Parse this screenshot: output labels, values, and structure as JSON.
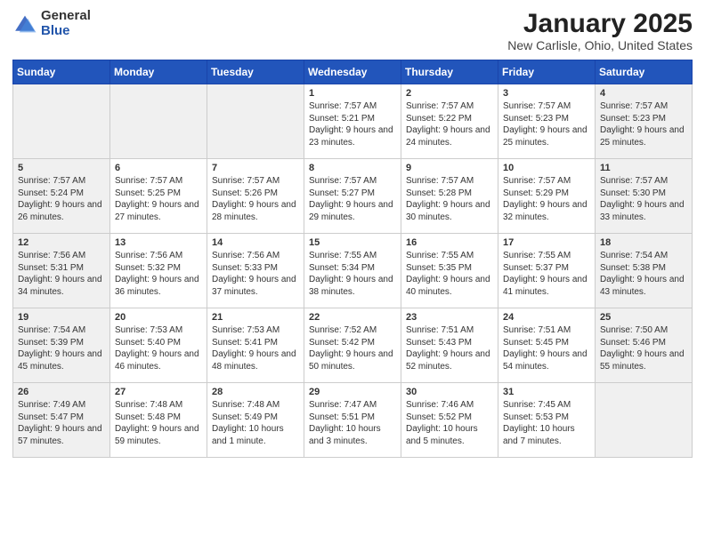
{
  "header": {
    "logo_general": "General",
    "logo_blue": "Blue",
    "title": "January 2025",
    "subtitle": "New Carlisle, Ohio, United States"
  },
  "weekdays": [
    "Sunday",
    "Monday",
    "Tuesday",
    "Wednesday",
    "Thursday",
    "Friday",
    "Saturday"
  ],
  "weeks": [
    [
      {
        "day": "",
        "detail": "",
        "shaded": true
      },
      {
        "day": "",
        "detail": "",
        "shaded": true
      },
      {
        "day": "",
        "detail": "",
        "shaded": true
      },
      {
        "day": "1",
        "detail": "Sunrise: 7:57 AM\nSunset: 5:21 PM\nDaylight: 9 hours and 23 minutes.",
        "shaded": false
      },
      {
        "day": "2",
        "detail": "Sunrise: 7:57 AM\nSunset: 5:22 PM\nDaylight: 9 hours and 24 minutes.",
        "shaded": false
      },
      {
        "day": "3",
        "detail": "Sunrise: 7:57 AM\nSunset: 5:23 PM\nDaylight: 9 hours and 25 minutes.",
        "shaded": false
      },
      {
        "day": "4",
        "detail": "Sunrise: 7:57 AM\nSunset: 5:23 PM\nDaylight: 9 hours and 25 minutes.",
        "shaded": true
      }
    ],
    [
      {
        "day": "5",
        "detail": "Sunrise: 7:57 AM\nSunset: 5:24 PM\nDaylight: 9 hours and 26 minutes.",
        "shaded": true
      },
      {
        "day": "6",
        "detail": "Sunrise: 7:57 AM\nSunset: 5:25 PM\nDaylight: 9 hours and 27 minutes.",
        "shaded": false
      },
      {
        "day": "7",
        "detail": "Sunrise: 7:57 AM\nSunset: 5:26 PM\nDaylight: 9 hours and 28 minutes.",
        "shaded": false
      },
      {
        "day": "8",
        "detail": "Sunrise: 7:57 AM\nSunset: 5:27 PM\nDaylight: 9 hours and 29 minutes.",
        "shaded": false
      },
      {
        "day": "9",
        "detail": "Sunrise: 7:57 AM\nSunset: 5:28 PM\nDaylight: 9 hours and 30 minutes.",
        "shaded": false
      },
      {
        "day": "10",
        "detail": "Sunrise: 7:57 AM\nSunset: 5:29 PM\nDaylight: 9 hours and 32 minutes.",
        "shaded": false
      },
      {
        "day": "11",
        "detail": "Sunrise: 7:57 AM\nSunset: 5:30 PM\nDaylight: 9 hours and 33 minutes.",
        "shaded": true
      }
    ],
    [
      {
        "day": "12",
        "detail": "Sunrise: 7:56 AM\nSunset: 5:31 PM\nDaylight: 9 hours and 34 minutes.",
        "shaded": true
      },
      {
        "day": "13",
        "detail": "Sunrise: 7:56 AM\nSunset: 5:32 PM\nDaylight: 9 hours and 36 minutes.",
        "shaded": false
      },
      {
        "day": "14",
        "detail": "Sunrise: 7:56 AM\nSunset: 5:33 PM\nDaylight: 9 hours and 37 minutes.",
        "shaded": false
      },
      {
        "day": "15",
        "detail": "Sunrise: 7:55 AM\nSunset: 5:34 PM\nDaylight: 9 hours and 38 minutes.",
        "shaded": false
      },
      {
        "day": "16",
        "detail": "Sunrise: 7:55 AM\nSunset: 5:35 PM\nDaylight: 9 hours and 40 minutes.",
        "shaded": false
      },
      {
        "day": "17",
        "detail": "Sunrise: 7:55 AM\nSunset: 5:37 PM\nDaylight: 9 hours and 41 minutes.",
        "shaded": false
      },
      {
        "day": "18",
        "detail": "Sunrise: 7:54 AM\nSunset: 5:38 PM\nDaylight: 9 hours and 43 minutes.",
        "shaded": true
      }
    ],
    [
      {
        "day": "19",
        "detail": "Sunrise: 7:54 AM\nSunset: 5:39 PM\nDaylight: 9 hours and 45 minutes.",
        "shaded": true
      },
      {
        "day": "20",
        "detail": "Sunrise: 7:53 AM\nSunset: 5:40 PM\nDaylight: 9 hours and 46 minutes.",
        "shaded": false
      },
      {
        "day": "21",
        "detail": "Sunrise: 7:53 AM\nSunset: 5:41 PM\nDaylight: 9 hours and 48 minutes.",
        "shaded": false
      },
      {
        "day": "22",
        "detail": "Sunrise: 7:52 AM\nSunset: 5:42 PM\nDaylight: 9 hours and 50 minutes.",
        "shaded": false
      },
      {
        "day": "23",
        "detail": "Sunrise: 7:51 AM\nSunset: 5:43 PM\nDaylight: 9 hours and 52 minutes.",
        "shaded": false
      },
      {
        "day": "24",
        "detail": "Sunrise: 7:51 AM\nSunset: 5:45 PM\nDaylight: 9 hours and 54 minutes.",
        "shaded": false
      },
      {
        "day": "25",
        "detail": "Sunrise: 7:50 AM\nSunset: 5:46 PM\nDaylight: 9 hours and 55 minutes.",
        "shaded": true
      }
    ],
    [
      {
        "day": "26",
        "detail": "Sunrise: 7:49 AM\nSunset: 5:47 PM\nDaylight: 9 hours and 57 minutes.",
        "shaded": true
      },
      {
        "day": "27",
        "detail": "Sunrise: 7:48 AM\nSunset: 5:48 PM\nDaylight: 9 hours and 59 minutes.",
        "shaded": false
      },
      {
        "day": "28",
        "detail": "Sunrise: 7:48 AM\nSunset: 5:49 PM\nDaylight: 10 hours and 1 minute.",
        "shaded": false
      },
      {
        "day": "29",
        "detail": "Sunrise: 7:47 AM\nSunset: 5:51 PM\nDaylight: 10 hours and 3 minutes.",
        "shaded": false
      },
      {
        "day": "30",
        "detail": "Sunrise: 7:46 AM\nSunset: 5:52 PM\nDaylight: 10 hours and 5 minutes.",
        "shaded": false
      },
      {
        "day": "31",
        "detail": "Sunrise: 7:45 AM\nSunset: 5:53 PM\nDaylight: 10 hours and 7 minutes.",
        "shaded": false
      },
      {
        "day": "",
        "detail": "",
        "shaded": true
      }
    ]
  ]
}
